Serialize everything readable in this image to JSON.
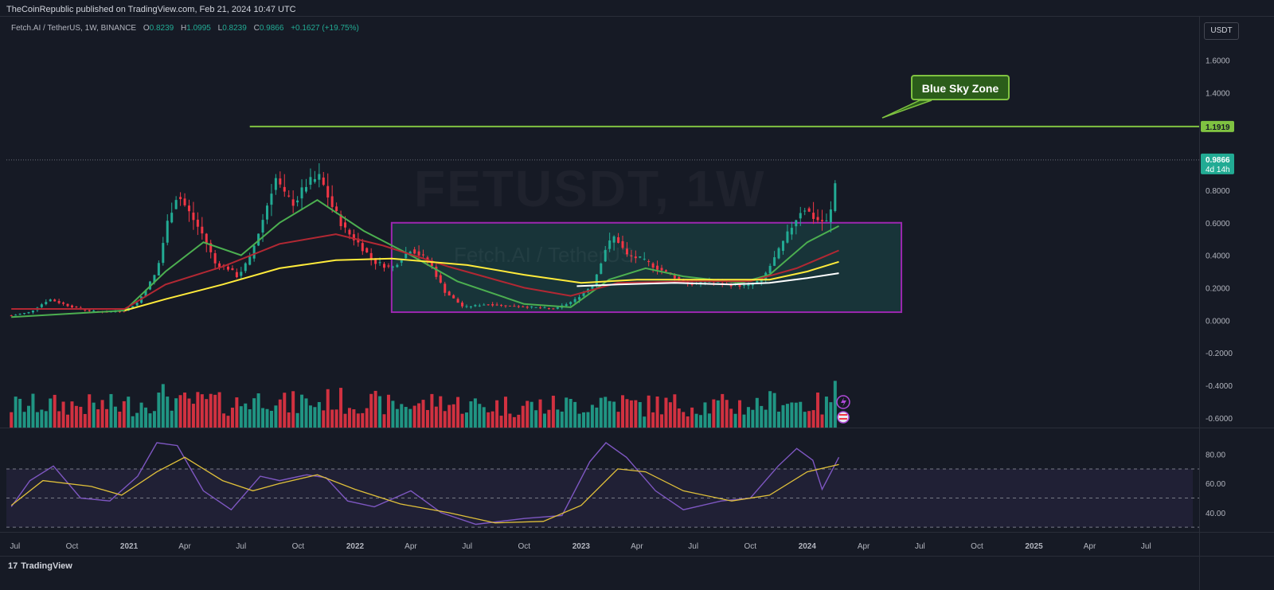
{
  "header": {
    "publish_line": "TheCoinRepublic published on TradingView.com, Feb 21, 2024 10:47 UTC",
    "symbol": "Fetch.AI / TetherUS, 1W, BINANCE",
    "o_label": "O",
    "o_value": "0.8239",
    "h_label": "H",
    "h_value": "1.0995",
    "l_label": "L",
    "l_value": "0.8239",
    "c_label": "C",
    "c_value": "0.9866",
    "change": "+0.1627 (+19.75%)",
    "unit": "USDT"
  },
  "watermark": {
    "ticker": "FETUSDT, 1W",
    "name": "Fetch.AI / TetherUS"
  },
  "annotation": {
    "label": "Blue Sky Zone"
  },
  "footer": {
    "logo": "TradingView"
  },
  "colors": {
    "background": "#161a25",
    "up": "#22ab94",
    "down": "#f23645",
    "ema_green": "#4caf50",
    "ema_red": "#b22833",
    "ema_yellow": "#ffeb3b",
    "ema_white": "#ffffff",
    "rsi": "#7e57c2",
    "rsi_ma": "#e0c03a",
    "resistance": "#7fc241",
    "box": "#9c27b0"
  },
  "chart_data": {
    "type": "candlestick",
    "interval": "1W",
    "x_ticks": [
      "Jul",
      "Oct",
      "2021",
      "Apr",
      "Jul",
      "Oct",
      "2022",
      "Apr",
      "Jul",
      "Oct",
      "2023",
      "Apr",
      "Jul",
      "Oct",
      "2024",
      "Apr",
      "Jul",
      "Oct",
      "2025",
      "Apr",
      "Jul"
    ],
    "x_tick_dates": [
      "2020-07-01",
      "2020-10-01",
      "2021-01-01",
      "2021-04-01",
      "2021-07-01",
      "2021-10-01",
      "2022-01-01",
      "2022-04-01",
      "2022-07-01",
      "2022-10-01",
      "2023-01-01",
      "2023-04-01",
      "2023-07-01",
      "2023-10-01",
      "2024-01-01",
      "2024-04-01",
      "2024-07-01",
      "2024-10-01",
      "2025-01-01",
      "2025-04-01",
      "2025-07-01"
    ],
    "y_ticks": [
      "1.6000",
      "1.4000",
      "1.2000",
      "1.0000",
      "0.8000",
      "0.6000",
      "0.4000",
      "0.2000",
      "0.0000",
      "-0.2000",
      "-0.4000",
      "-0.6000"
    ],
    "y_range": [
      -0.66,
      1.75
    ],
    "resistance": {
      "value": 1.1919,
      "label": "1.1919",
      "from": "2021-07-15"
    },
    "last_price": {
      "value": 0.9866,
      "label": "0.9866",
      "countdown": "4d 14h"
    },
    "consolidation_box": {
      "from": "2022-03-01",
      "to": "2024-06-01",
      "top": 0.6,
      "bottom": 0.05
    },
    "price_points": [
      [
        "2020-06-25",
        0.03
      ],
      [
        "2020-07-25",
        0.05
      ],
      [
        "2020-08-25",
        0.13
      ],
      [
        "2020-09-25",
        0.09
      ],
      [
        "2020-10-25",
        0.06
      ],
      [
        "2020-11-25",
        0.05
      ],
      [
        "2020-12-25",
        0.06
      ],
      [
        "2021-01-15",
        0.11
      ],
      [
        "2021-02-15",
        0.3
      ],
      [
        "2021-03-05",
        0.62
      ],
      [
        "2021-03-20",
        0.78
      ],
      [
        "2021-04-10",
        0.65
      ],
      [
        "2021-05-01",
        0.52
      ],
      [
        "2021-05-20",
        0.35
      ],
      [
        "2021-06-10",
        0.32
      ],
      [
        "2021-06-25",
        0.27
      ],
      [
        "2021-07-15",
        0.38
      ],
      [
        "2021-08-05",
        0.62
      ],
      [
        "2021-08-25",
        0.88
      ],
      [
        "2021-09-10",
        0.76
      ],
      [
        "2021-09-25",
        0.72
      ],
      [
        "2021-10-15",
        0.84
      ],
      [
        "2021-11-05",
        0.88
      ],
      [
        "2021-11-25",
        0.7
      ],
      [
        "2021-12-15",
        0.56
      ],
      [
        "2022-01-05",
        0.48
      ],
      [
        "2022-02-01",
        0.36
      ],
      [
        "2022-03-01",
        0.32
      ],
      [
        "2022-04-01",
        0.44
      ],
      [
        "2022-05-01",
        0.36
      ],
      [
        "2022-05-25",
        0.18
      ],
      [
        "2022-06-25",
        0.08
      ],
      [
        "2022-08-01",
        0.1
      ],
      [
        "2022-09-01",
        0.09
      ],
      [
        "2022-10-15",
        0.08
      ],
      [
        "2022-11-20",
        0.07
      ],
      [
        "2022-12-20",
        0.12
      ],
      [
        "2023-01-20",
        0.22
      ],
      [
        "2023-02-10",
        0.45
      ],
      [
        "2023-02-25",
        0.52
      ],
      [
        "2023-03-15",
        0.4
      ],
      [
        "2023-04-05",
        0.38
      ],
      [
        "2023-04-25",
        0.34
      ],
      [
        "2023-05-25",
        0.28
      ],
      [
        "2023-06-25",
        0.22
      ],
      [
        "2023-07-25",
        0.24
      ],
      [
        "2023-08-25",
        0.22
      ],
      [
        "2023-09-25",
        0.21
      ],
      [
        "2023-10-20",
        0.25
      ],
      [
        "2023-11-15",
        0.42
      ],
      [
        "2023-12-10",
        0.6
      ],
      [
        "2023-12-25",
        0.7
      ],
      [
        "2024-01-15",
        0.62
      ],
      [
        "2024-02-05",
        0.6
      ],
      [
        "2024-02-21",
        0.9866
      ]
    ],
    "ema_series": [
      {
        "name": "",
        "color": "ema_green",
        "points": [
          [
            "2020-06-25",
            0.02
          ],
          [
            "2020-12-25",
            0.06
          ],
          [
            "2021-03-01",
            0.3
          ],
          [
            "2021-05-01",
            0.48
          ],
          [
            "2021-07-01",
            0.4
          ],
          [
            "2021-09-01",
            0.6
          ],
          [
            "2021-11-01",
            0.74
          ],
          [
            "2022-01-15",
            0.55
          ],
          [
            "2022-04-01",
            0.4
          ],
          [
            "2022-06-15",
            0.24
          ],
          [
            "2022-10-01",
            0.1
          ],
          [
            "2022-12-15",
            0.08
          ],
          [
            "2023-02-15",
            0.25
          ],
          [
            "2023-04-15",
            0.32
          ],
          [
            "2023-06-15",
            0.27
          ],
          [
            "2023-09-15",
            0.23
          ],
          [
            "2023-11-01",
            0.28
          ],
          [
            "2024-01-01",
            0.48
          ],
          [
            "2024-02-21",
            0.58
          ]
        ]
      },
      {
        "name": "",
        "color": "ema_red",
        "points": [
          [
            "2020-06-25",
            0.07
          ],
          [
            "2020-12-25",
            0.07
          ],
          [
            "2021-03-01",
            0.22
          ],
          [
            "2021-06-01",
            0.33
          ],
          [
            "2021-09-01",
            0.47
          ],
          [
            "2021-12-01",
            0.53
          ],
          [
            "2022-02-15",
            0.46
          ],
          [
            "2022-06-01",
            0.33
          ],
          [
            "2022-10-01",
            0.2
          ],
          [
            "2022-12-15",
            0.15
          ],
          [
            "2023-03-01",
            0.23
          ],
          [
            "2023-07-01",
            0.24
          ],
          [
            "2023-10-01",
            0.24
          ],
          [
            "2023-12-15",
            0.32
          ],
          [
            "2024-02-21",
            0.43
          ]
        ]
      },
      {
        "name": "",
        "color": "ema_yellow",
        "points": [
          [
            "2020-12-25",
            0.06
          ],
          [
            "2021-03-01",
            0.13
          ],
          [
            "2021-06-01",
            0.22
          ],
          [
            "2021-09-01",
            0.32
          ],
          [
            "2021-12-01",
            0.37
          ],
          [
            "2022-03-01",
            0.38
          ],
          [
            "2022-07-01",
            0.34
          ],
          [
            "2022-10-01",
            0.28
          ],
          [
            "2023-01-01",
            0.23
          ],
          [
            "2023-04-01",
            0.25
          ],
          [
            "2023-08-01",
            0.25
          ],
          [
            "2023-11-01",
            0.25
          ],
          [
            "2024-01-01",
            0.3
          ],
          [
            "2024-02-21",
            0.36
          ]
        ]
      },
      {
        "name": "",
        "color": "ema_white",
        "points": [
          [
            "2022-12-25",
            0.21
          ],
          [
            "2023-03-01",
            0.22
          ],
          [
            "2023-06-01",
            0.23
          ],
          [
            "2023-09-01",
            0.22
          ],
          [
            "2023-11-01",
            0.23
          ],
          [
            "2024-01-01",
            0.26
          ],
          [
            "2024-02-21",
            0.29
          ]
        ]
      }
    ],
    "rsi": {
      "y_ticks": [
        "80.00",
        "60.00",
        "40.00"
      ],
      "y_range": [
        29,
        94
      ],
      "upper_band": 70,
      "mid": 50,
      "lower_band": 30,
      "points": [
        [
          "2020-06-25",
          44
        ],
        [
          "2020-07-25",
          62
        ],
        [
          "2020-09-01",
          72
        ],
        [
          "2020-10-15",
          50
        ],
        [
          "2020-12-01",
          48
        ],
        [
          "2021-01-15",
          65
        ],
        [
          "2021-02-15",
          88
        ],
        [
          "2021-03-20",
          86
        ],
        [
          "2021-05-01",
          55
        ],
        [
          "2021-06-15",
          42
        ],
        [
          "2021-08-01",
          65
        ],
        [
          "2021-09-01",
          62
        ],
        [
          "2021-10-15",
          66
        ],
        [
          "2021-11-15",
          64
        ],
        [
          "2021-12-20",
          48
        ],
        [
          "2022-02-01",
          44
        ],
        [
          "2022-04-01",
          55
        ],
        [
          "2022-05-20",
          40
        ],
        [
          "2022-07-15",
          32
        ],
        [
          "2022-10-01",
          36
        ],
        [
          "2022-12-01",
          38
        ],
        [
          "2023-01-15",
          75
        ],
        [
          "2023-02-10",
          88
        ],
        [
          "2023-03-15",
          78
        ],
        [
          "2023-05-01",
          55
        ],
        [
          "2023-06-15",
          42
        ],
        [
          "2023-08-15",
          48
        ],
        [
          "2023-10-01",
          50
        ],
        [
          "2023-11-15",
          72
        ],
        [
          "2023-12-15",
          84
        ],
        [
          "2024-01-10",
          76
        ],
        [
          "2024-01-25",
          56
        ],
        [
          "2024-02-21",
          78
        ]
      ],
      "ma_points": [
        [
          "2020-06-25",
          45
        ],
        [
          "2020-08-15",
          62
        ],
        [
          "2020-11-01",
          58
        ],
        [
          "2020-12-20",
          52
        ],
        [
          "2021-02-15",
          68
        ],
        [
          "2021-04-01",
          78
        ],
        [
          "2021-06-01",
          62
        ],
        [
          "2021-07-20",
          55
        ],
        [
          "2021-09-01",
          60
        ],
        [
          "2021-11-01",
          66
        ],
        [
          "2022-01-01",
          56
        ],
        [
          "2022-03-15",
          46
        ],
        [
          "2022-06-01",
          40
        ],
        [
          "2022-08-15",
          33
        ],
        [
          "2022-11-01",
          34
        ],
        [
          "2023-01-01",
          45
        ],
        [
          "2023-03-01",
          70
        ],
        [
          "2023-04-15",
          68
        ],
        [
          "2023-06-15",
          55
        ],
        [
          "2023-09-01",
          48
        ],
        [
          "2023-11-01",
          52
        ],
        [
          "2024-01-01",
          68
        ],
        [
          "2024-02-21",
          73
        ]
      ]
    },
    "volume": {
      "note": ""
    }
  }
}
